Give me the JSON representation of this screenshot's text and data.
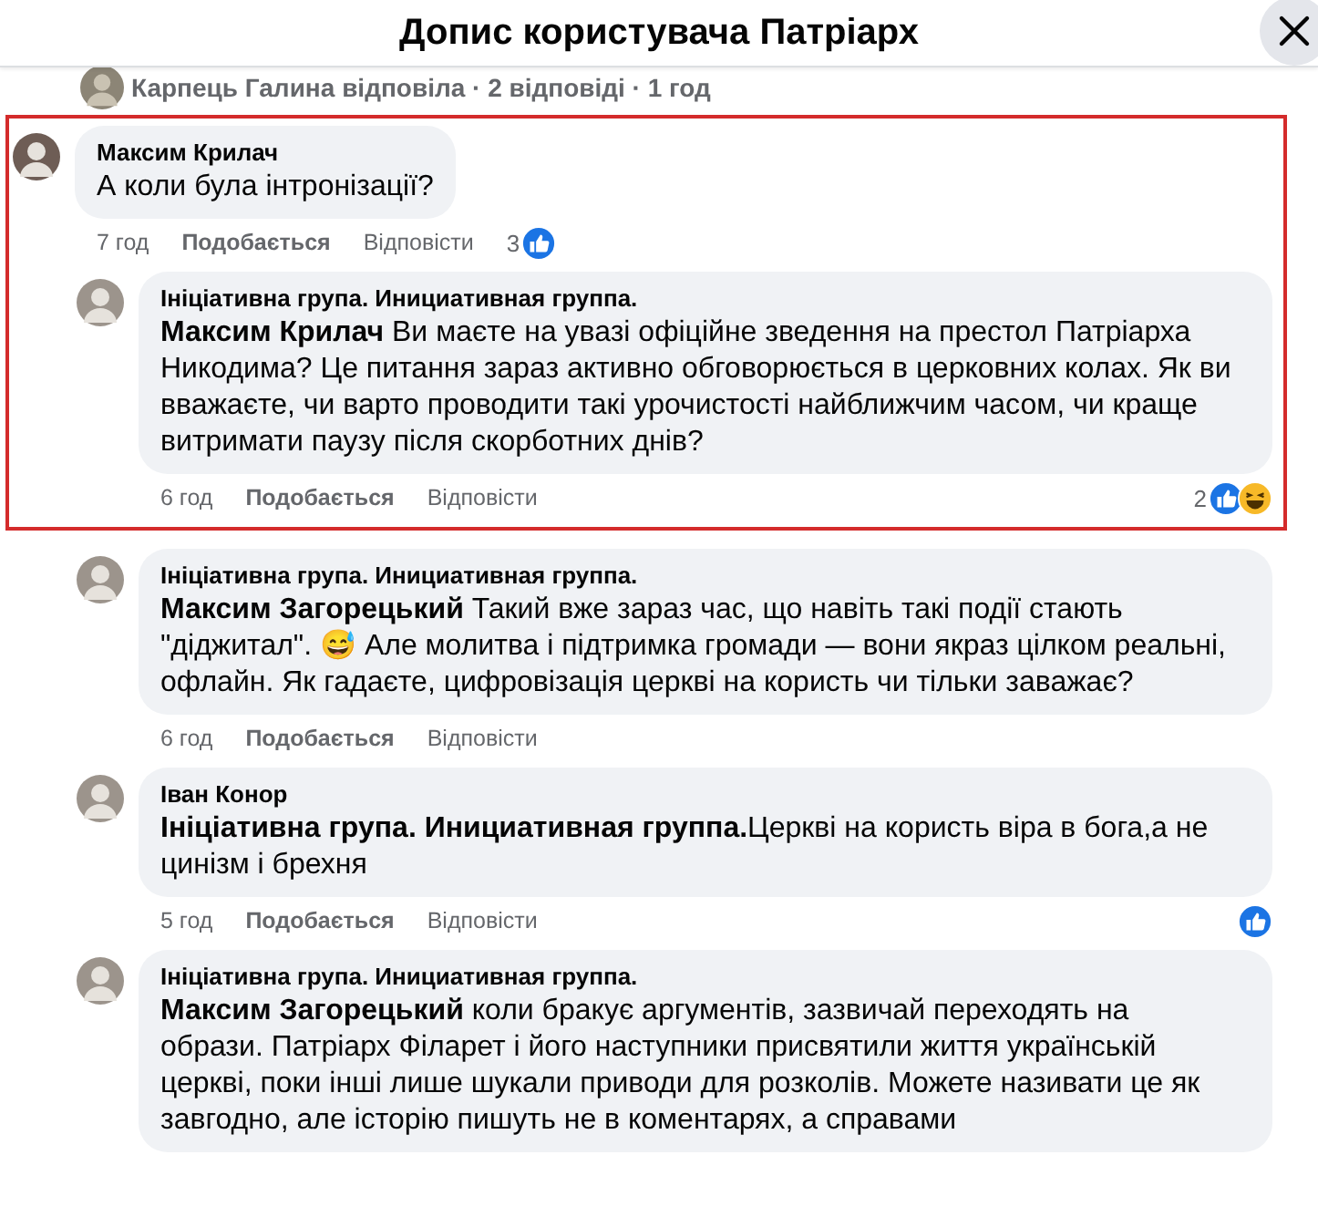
{
  "header": {
    "title": "Допис користувача Патріарх"
  },
  "reply_summary": {
    "text": "Карпець Галина відповіла · 2 відповіді · 1 год"
  },
  "groups": [
    {
      "highlighted": true,
      "comments": [
        {
          "kind": "top",
          "author": "Максим Крилач",
          "text": "А коли була інтронізації?",
          "time": "7 год",
          "like": "Подобається",
          "reply": "Відповісти",
          "reaction_count": "3",
          "reactions": [
            {
              "kind": "like"
            }
          ]
        },
        {
          "kind": "reply",
          "author": "Ініціативна група. Инициативная группа.",
          "mention": "Максим Крилач",
          "text": " Ви маєте на увазі офіційне зведення на престол Патріарха Никодима? Це питання зараз активно обговорюється в церковних колах. Як ви вважаєте, чи варто проводити такі урочистості найближчим часом, чи краще витримати паузу після скорботних днів?",
          "time": "6 год",
          "like": "Подобається",
          "reply": "Відповісти",
          "reaction_count": "2",
          "reactions": [
            {
              "kind": "like"
            },
            {
              "kind": "haha"
            }
          ]
        }
      ]
    },
    {
      "highlighted": false,
      "comments": [
        {
          "kind": "reply",
          "author": "Ініціативна група. Инициативная группа.",
          "mention": "Максим Загорецький",
          "text": " Такий вже зараз час, що навіть такі події стають \"діджитал\". 😅 Але молитва і підтримка громади — вони якраз цілком реальні, офлайн. Як гадаєте, цифровізація церкві на користь чи тільки заважає?",
          "time": "6 год",
          "like": "Подобається",
          "reply": "Відповісти"
        },
        {
          "kind": "reply",
          "author": "Іван Конор",
          "mention": "Ініціативна група. Инициативная группа.",
          "text": "Церкві на користь віра в бога,а не цинізм і брехня",
          "time": "5 год",
          "like": "Подобається",
          "reply": "Відповісти",
          "reactions": [
            {
              "kind": "like"
            }
          ]
        },
        {
          "kind": "reply",
          "author": "Ініціативна група. Инициативная группа.",
          "mention": "Максим Загорецький",
          "text": " коли бракує аргументів, зазвичай переходять на образи. Патріарх Філарет і його наступники присвятили життя українській церкві, поки інші лише шукали приводи для розколів. Можете називати це як завгодно, але історію пишуть не в коментарях, а справами"
        }
      ]
    }
  ]
}
